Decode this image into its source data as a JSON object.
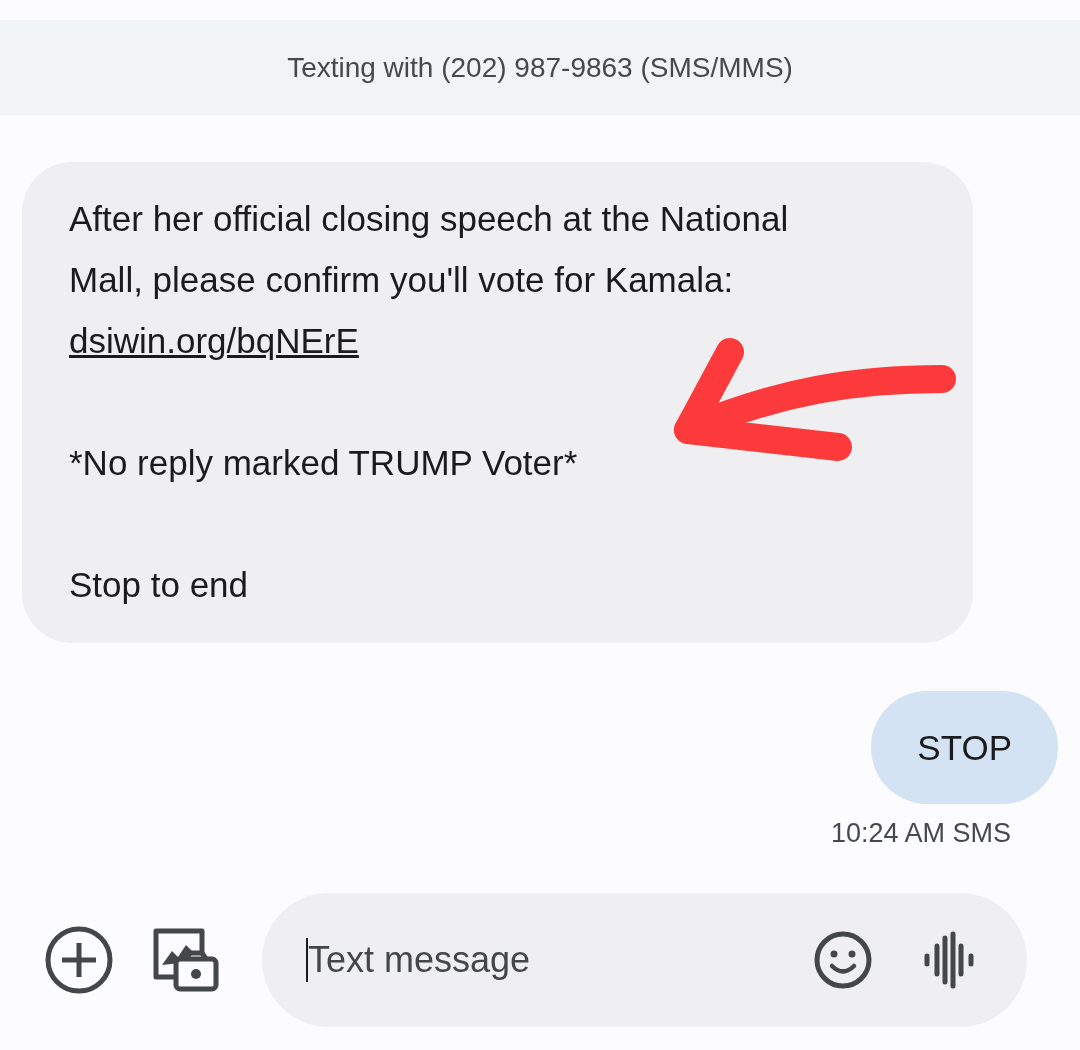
{
  "header": {
    "title": "Texting with (202) 987-9863 (SMS/MMS)"
  },
  "messages": [
    {
      "kind": "incoming",
      "blocks": [
        [
          {
            "kind": "text",
            "text": "After her official closing speech at the National Mall, please confirm you'll vote for Kamala:"
          },
          {
            "kind": "link",
            "text": "dsiwin.org/bqNErE"
          }
        ],
        [
          {
            "kind": "text",
            "text": "*No reply marked TRUMP Voter*"
          }
        ],
        [
          {
            "kind": "text",
            "text": "Stop to end"
          }
        ]
      ]
    },
    {
      "kind": "outgoing",
      "blocks": [
        [
          {
            "kind": "text",
            "text": "STOP"
          }
        ]
      ],
      "meta": "10:24 AM SMS"
    }
  ],
  "annotation": {
    "kind": "arrow"
  },
  "composer": {
    "placeholder": "Text message"
  }
}
